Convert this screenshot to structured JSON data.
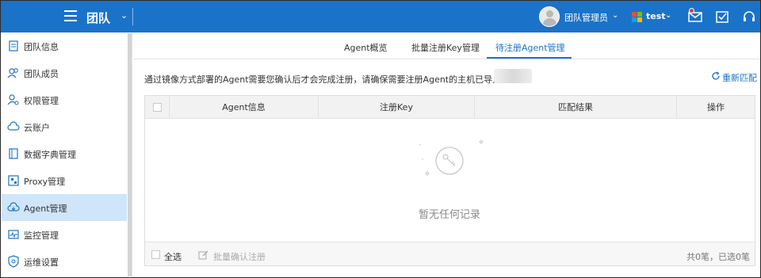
{
  "header": {
    "team_label": "团队",
    "user_name": "团队管理员",
    "tenant_name": "test"
  },
  "sidebar": {
    "items": [
      {
        "label": "团队信息",
        "icon": "document-icon"
      },
      {
        "label": "团队成员",
        "icon": "users-icon"
      },
      {
        "label": "权限管理",
        "icon": "user-key-icon"
      },
      {
        "label": "云账户",
        "icon": "cloud-icon"
      },
      {
        "label": "数据字典管理",
        "icon": "book-icon"
      },
      {
        "label": "Proxy管理",
        "icon": "proxy-icon"
      },
      {
        "label": "Agent管理",
        "icon": "cloud-agent-icon",
        "active": true
      },
      {
        "label": "监控管理",
        "icon": "monitor-icon"
      },
      {
        "label": "运维设置",
        "icon": "shield-gear-icon"
      }
    ]
  },
  "tabs": [
    {
      "label": "Agent概览"
    },
    {
      "label": "批量注册Key管理"
    },
    {
      "label": "待注册Agent管理",
      "active": true
    }
  ],
  "notice": "通过镜像方式部署的Agent需要您确认后才会完成注册，请确保需要注册Agent的主机已导入至",
  "rematch_label": "重新匹配",
  "table": {
    "columns": [
      "Agent信息",
      "注册Key",
      "匹配结果",
      "操作"
    ],
    "rows": [],
    "empty_text": "暂无任何记录",
    "footer": {
      "select_all": "全选",
      "batch_confirm": "批量确认注册",
      "summary": "共0笔，已选0笔"
    }
  },
  "colors": {
    "brand": "#1a73c9",
    "active_sidebar": "#cfe5f9"
  }
}
